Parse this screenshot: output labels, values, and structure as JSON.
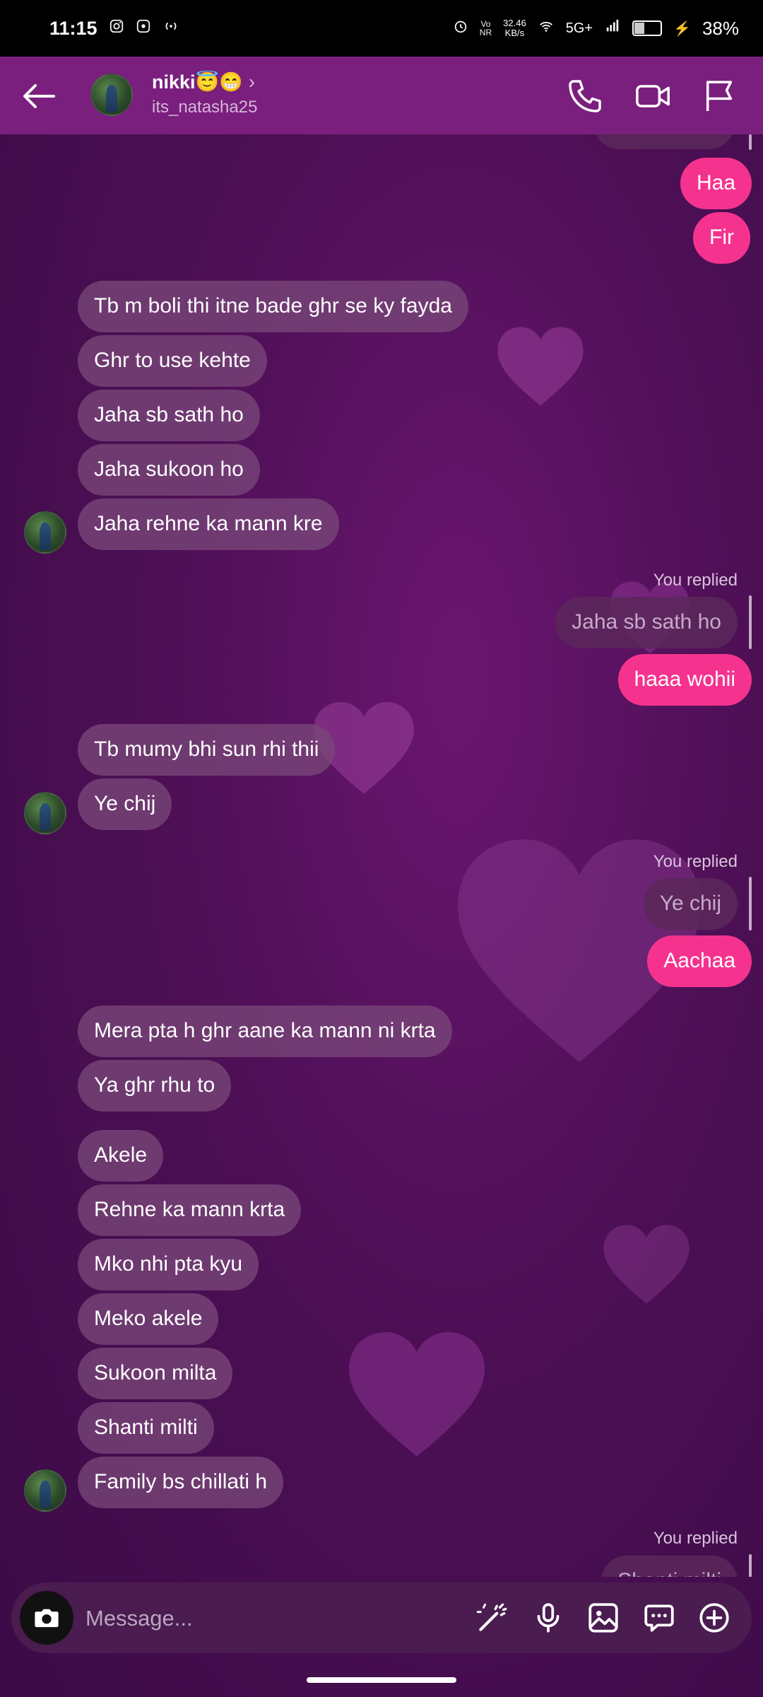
{
  "status_bar": {
    "time": "11:15",
    "net_speed_top": "32.46",
    "net_speed_bottom": "KB/s",
    "network": "5G+",
    "battery": "38%",
    "icons": [
      "instagram-icon",
      "app-icon",
      "hotspot-icon",
      "alarm-icon",
      "volte-icon",
      "wifi-icon",
      "signal-icon",
      "battery-icon",
      "charging-icon"
    ]
  },
  "header": {
    "contact_name": "nikki😇😁",
    "username": "its_natasha25",
    "chevron": "›",
    "icons": [
      "back-arrow-icon",
      "phone-icon",
      "video-camera-icon",
      "flag-icon"
    ]
  },
  "messages": {
    "out_haa": "Haa",
    "out_fir": "Fir",
    "in_1": "Tb m boli thi itne bade ghr se ky fayda",
    "in_2": "Ghr to use kehte",
    "in_3": "Jaha sb sath ho",
    "in_4": "Jaha sukoon ho",
    "in_5": "Jaha rehne ka mann kre",
    "reply1_label": "You replied",
    "reply1_quote": "Jaha sb sath ho",
    "out_haaa_wohii": "haaa wohii",
    "in_6": "Tb mumy bhi sun rhi thii",
    "in_7": "Ye chij",
    "reply2_label": "You replied",
    "reply2_quote": "Ye chij",
    "out_aachaa": "Aachaa",
    "in_8": "Mera pta h ghr aane ka mann ni krta",
    "in_9": "Ya ghr rhu to",
    "in_10": "Akele",
    "in_11": "Rehne ka mann krta",
    "in_12": "Mko nhi pta kyu",
    "in_13": "Meko akele",
    "in_14": "Sukoon milta",
    "in_15": "Shanti milti",
    "in_16": "Family bs chillati h",
    "reply3_label": "You replied",
    "reply3_quote": "Shanti milti"
  },
  "composer": {
    "placeholder": "Message...",
    "icons": [
      "camera-icon",
      "magic-wand-icon",
      "microphone-icon",
      "gallery-icon",
      "sticker-chat-icon",
      "plus-icon"
    ]
  },
  "colors": {
    "header_bg": "#7a1f7d",
    "outgoing_bubble": "#f5338f",
    "incoming_bubble": "#784678",
    "background": "#4d0f55"
  }
}
